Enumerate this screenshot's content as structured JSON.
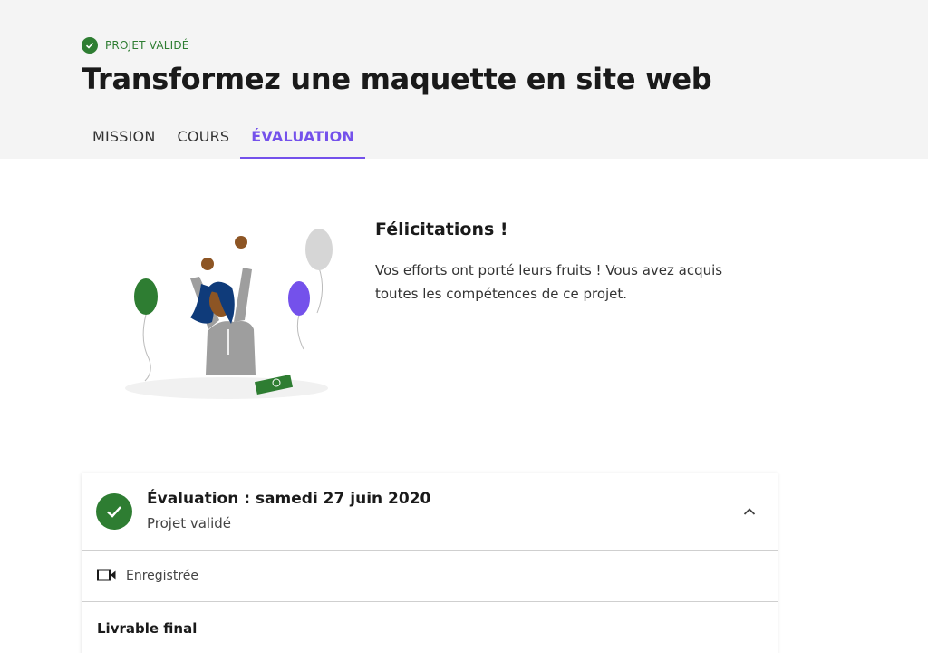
{
  "header": {
    "status_label": "PROJET VALIDÉ",
    "title": "Transformez une maquette en site web",
    "tabs": [
      {
        "label": "MISSION",
        "active": false
      },
      {
        "label": "COURS",
        "active": false
      },
      {
        "label": "ÉVALUATION",
        "active": true
      }
    ]
  },
  "congrats": {
    "title": "Félicitations !",
    "text": "Vos efforts ont porté leurs fruits ! Vous avez acquis toutes les compétences de ce projet."
  },
  "evaluation_card": {
    "title": "Évaluation : samedi 27 juin 2020",
    "subtitle": "Projet validé",
    "recording_label": "Enregistrée",
    "final_label": "Livrable final"
  },
  "colors": {
    "accent": "#7451eb",
    "success": "#2e7d32",
    "header_bg": "#f4f4f4"
  },
  "icons": [
    "check-icon",
    "chevron-up-icon",
    "video-camera-icon"
  ]
}
